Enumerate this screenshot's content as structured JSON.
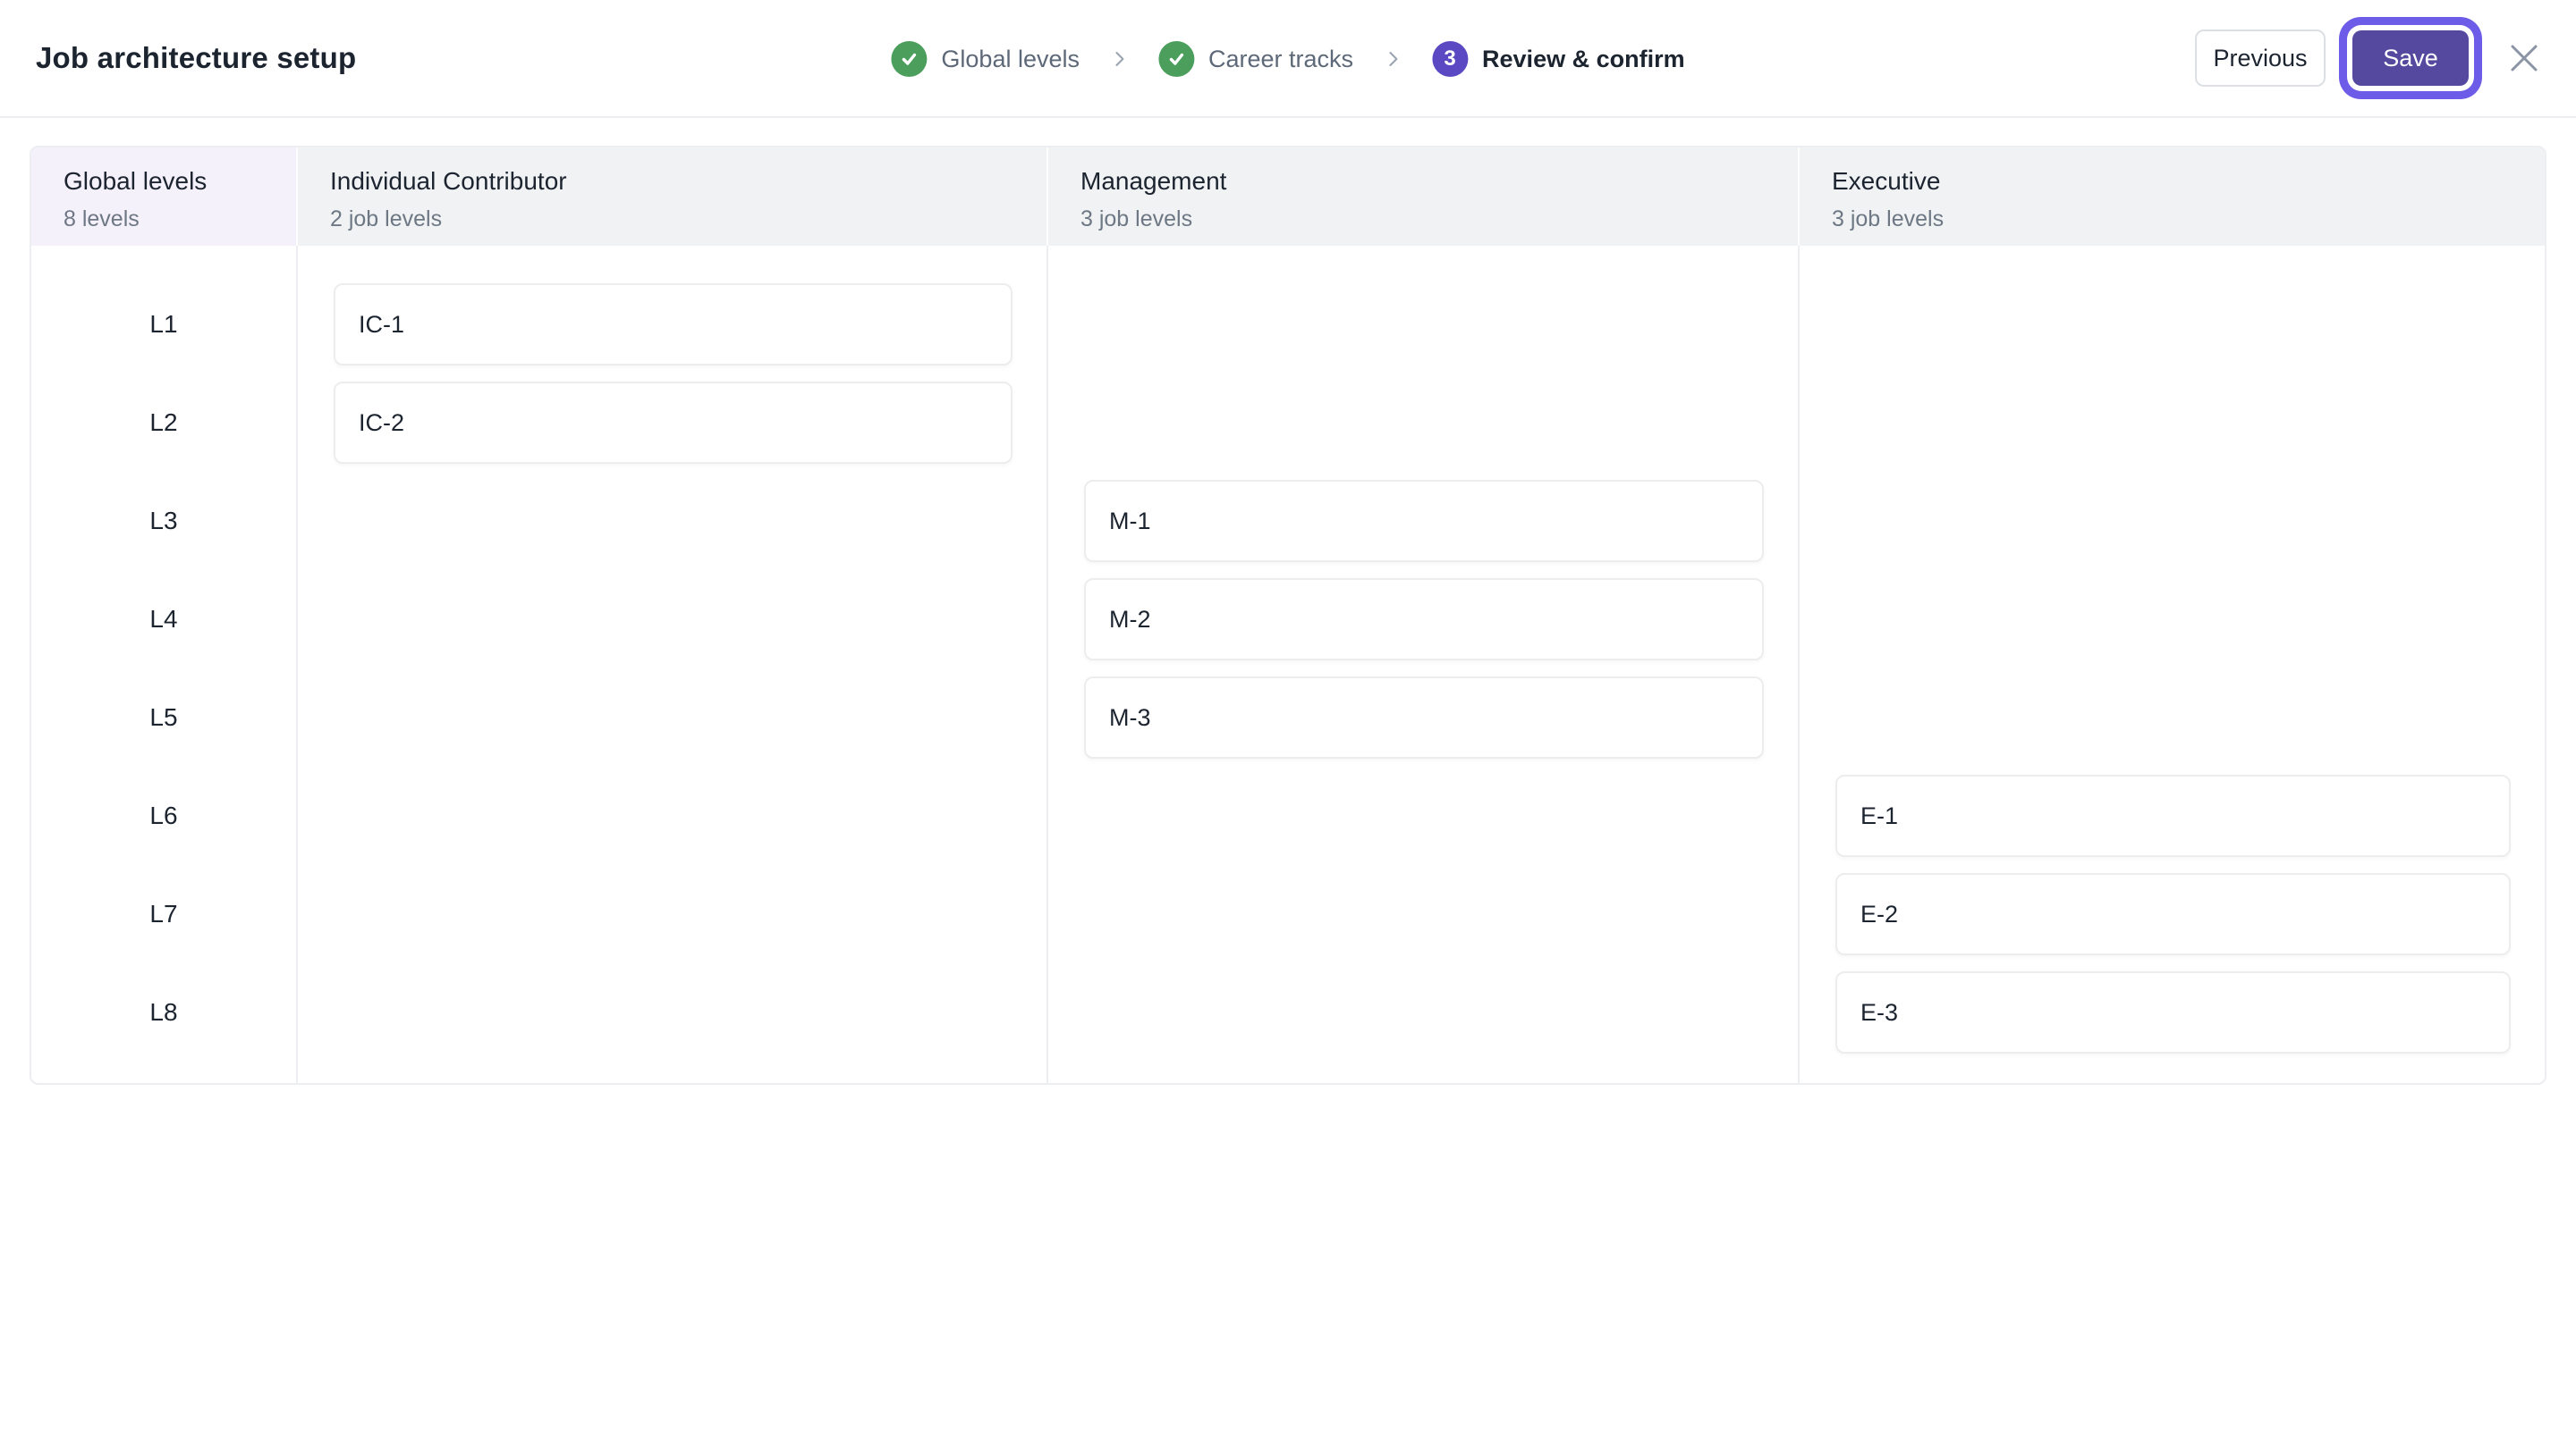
{
  "header": {
    "title": "Job architecture setup",
    "steps": [
      {
        "label": "Global levels",
        "status": "complete"
      },
      {
        "label": "Career tracks",
        "status": "complete"
      },
      {
        "label": "Review & confirm",
        "status": "current",
        "number": "3"
      }
    ],
    "previous_label": "Previous",
    "save_label": "Save"
  },
  "table": {
    "levels_column": {
      "title": "Global levels",
      "subtitle": "8 levels",
      "levels": [
        "L1",
        "L2",
        "L3",
        "L4",
        "L5",
        "L6",
        "L7",
        "L8"
      ]
    },
    "row_count": 8,
    "tracks": [
      {
        "title": "Individual Contributor",
        "subtitle": "2 job levels",
        "cards": [
          {
            "label": "IC-1",
            "row": 1
          },
          {
            "label": "IC-2",
            "row": 2
          }
        ]
      },
      {
        "title": "Management",
        "subtitle": "3 job levels",
        "cards": [
          {
            "label": "M-1",
            "row": 3
          },
          {
            "label": "M-2",
            "row": 4
          },
          {
            "label": "M-3",
            "row": 5
          }
        ]
      },
      {
        "title": "Executive",
        "subtitle": "3 job levels",
        "cards": [
          {
            "label": "E-1",
            "row": 6
          },
          {
            "label": "E-2",
            "row": 7
          },
          {
            "label": "E-3",
            "row": 8
          }
        ]
      }
    ]
  },
  "colors": {
    "accent_purple": "#5a49c2",
    "save_fill": "#55489f",
    "save_focus_ring": "#6c5ce8",
    "step_complete_green": "#4c9e5d",
    "levels_header_bg": "#f5f1fb",
    "track_header_bg": "#f0f2f4",
    "border": "#eceef1",
    "text_dark": "#1c2430",
    "text_gray": "#6e7885"
  },
  "icons": {
    "check": "check-icon",
    "chevron": "chevron-right-icon",
    "close": "close-icon"
  }
}
